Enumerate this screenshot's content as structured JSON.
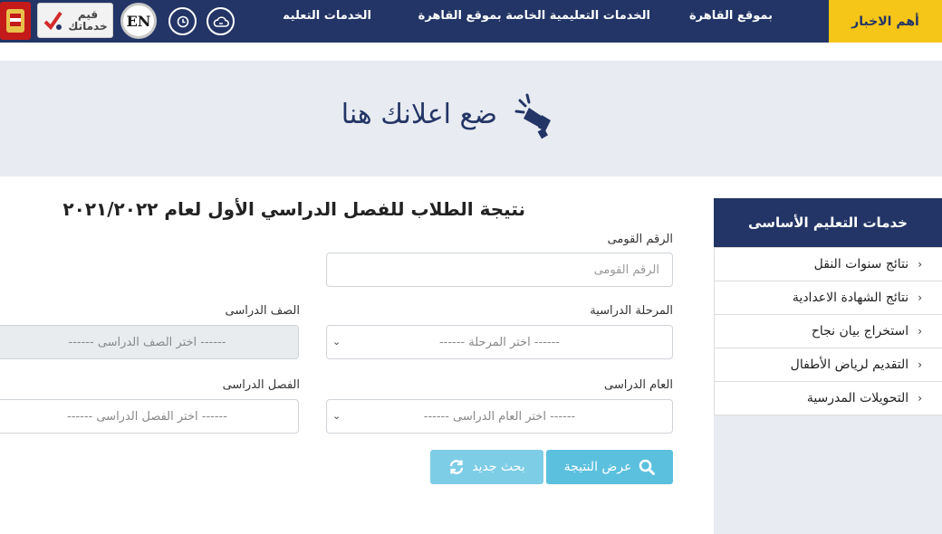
{
  "header": {
    "breaking_news": "أهم الاخبار",
    "nav": {
      "cairo": "بموقع القاهرة",
      "education": "الخدمات التعليمية الخاصة بموقع القاهرة",
      "egov": "الخدمات التعليمية"
    },
    "language_button": "EN",
    "rate_services": "قيم خدماتك"
  },
  "ad_banner": {
    "text": "ضع اعلانك هنا"
  },
  "main": {
    "heading": "نتيجة الطلاب للفصل الدراسي الأول لعام ٢٠٢١/٢٠٢٢",
    "national_id": {
      "label": "الرقم القومى",
      "placeholder": "الرقم القومى"
    },
    "stage": {
      "label": "المرحلة الدراسية",
      "value": "------ اختر المرحلة ------"
    },
    "grade": {
      "label": "الصف الدراسى",
      "value": "------ اختر الصف الدراسى ------"
    },
    "year": {
      "label": "العام الدراسى",
      "value": "------ اختر العام الدراسى ------"
    },
    "term": {
      "label": "الفصل الدراسى",
      "value": "------ اختر الفصل الدراسى ------"
    },
    "show_result_button": "عرض النتيجة",
    "new_search_button": "بحث جديد"
  },
  "sidebar": {
    "title": "خدمات التعليم الأساسى",
    "items": [
      {
        "label": "نتائج سنوات النقل"
      },
      {
        "label": "نتائج الشهادة الاعدادية"
      },
      {
        "label": "استخراج بيان نجاح"
      },
      {
        "label": "التقديم لرياض الأطفال"
      },
      {
        "label": "التحويلات المدرسية"
      }
    ]
  },
  "colors": {
    "navy": "#233566",
    "accent_yellow": "#f5c518",
    "button_blue": "#5bc0de",
    "banner_gray": "#e8ebf1"
  },
  "icons": [
    "cloud-icon",
    "clock-icon",
    "megaphone-icon",
    "search-icon",
    "refresh-icon",
    "chevron-right-icon",
    "caret-down-icon",
    "egypt-seal-icon"
  ]
}
